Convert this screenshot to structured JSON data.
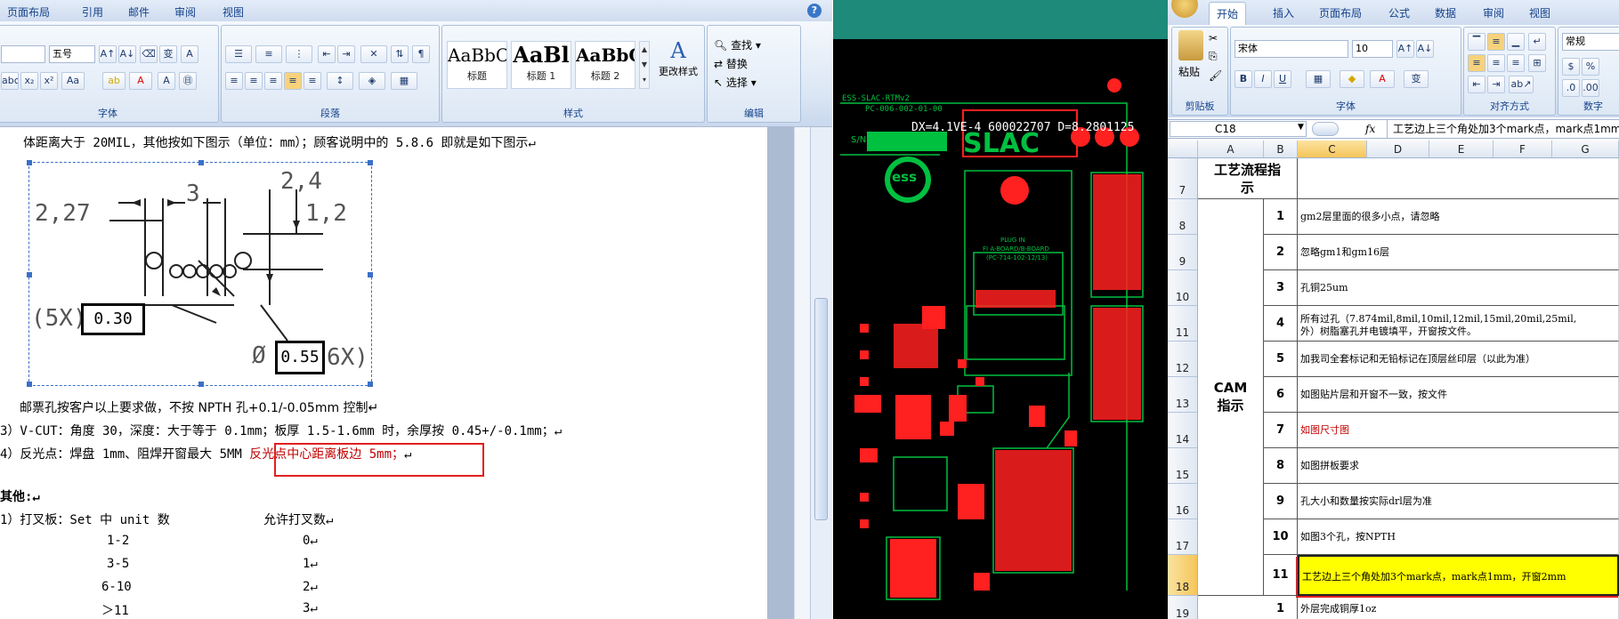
{
  "word": {
    "tabs": [
      "页面布局",
      "引用",
      "邮件",
      "审阅",
      "视图"
    ],
    "help": "?",
    "font_size": "五号",
    "font_group_label": "字体",
    "paragraph_group_label": "段落",
    "styles_group_label": "样式",
    "edit_group_label": "编辑",
    "styles": [
      {
        "preview": "AaBbC",
        "caption": "标题"
      },
      {
        "preview": "AaBl",
        "caption": "标题 1"
      },
      {
        "preview": "AaBbC",
        "caption": "标题 2"
      }
    ],
    "change_styles": "更改样式",
    "find": "查找",
    "replace": "替换",
    "select": "选择",
    "doc_lines": {
      "line1": "体距离大于 20MIL，其他按如下图示（单位：mm）；顾客说明中的 5.8.6 即就是如下图示↵",
      "line2": "邮票孔按客户以上要求做，不按 NPTH 孔+0.1/-0.05mm 控制↵",
      "line3": "3）V-CUT：角度 30，深度：大于等于 0.1mm；板厚 1.5-1.6mm 时，余厚按 0.45+/-0.1mm；↵",
      "line4a": "4）反光点：焊盘 1mm、阻焊开窗最大 5MM",
      "line4b": "反光点中心距离板边 5mm；",
      "line4c": "↵",
      "other": "其他:↵",
      "line5a": "1）打叉板：Set 中 unit 数",
      "line5b": "允许打叉数↵"
    },
    "table_rows": [
      {
        "range": "1-2",
        "count": "0↵"
      },
      {
        "range": "3-5",
        "count": "1↵"
      },
      {
        "range": "6-10",
        "count": "2↵"
      },
      {
        "range": "＞11",
        "count": "3↵"
      }
    ],
    "figure_labels": {
      "a": "2,27",
      "b": "3",
      "c": "2,4",
      "d": "1,2",
      "e": "(5X)",
      "f": "0.30",
      "g": "Ø",
      "h": "0.55",
      "i": "6X)"
    }
  },
  "pcb": {
    "text1": "ESS-SLAC-RTMv2",
    "text2": "PC-006-002-01-00",
    "coord": "DX=4.1VE-4 600022707 D=8.2801125",
    "sn": "S/N",
    "logo": "ess",
    "brand": "SLAC",
    "plug": "PLUG IN",
    "plug2": "FI A-BOARD/B-BOARD",
    "plug3": "(PC-714-102-12/13)"
  },
  "excel": {
    "tabs": [
      "开始",
      "插入",
      "页面布局",
      "公式",
      "数据",
      "审阅",
      "视图"
    ],
    "font_name": "宋体",
    "font_size": "10",
    "number_format": "常规",
    "paste": "粘贴",
    "clipboard_label": "剪贴板",
    "font_label": "字体",
    "align_label": "对齐方式",
    "number_label": "数字",
    "name_box": "C18",
    "fx": "fx",
    "formula": "工艺边上三个角处加3个mark点，mark点1mm，开窗2mm",
    "columns": [
      "A",
      "B",
      "C",
      "D",
      "E",
      "F",
      "G"
    ],
    "header_title": "工艺流程指示",
    "cam_label": "CAM指示",
    "rows": [
      {
        "rownum": "7",
        "num": "",
        "text": ""
      },
      {
        "rownum": "8",
        "num": "1",
        "text": "gm2层里面的很多小点，请忽略"
      },
      {
        "rownum": "9",
        "num": "2",
        "text": "忽略gm1和gm16层"
      },
      {
        "rownum": "10",
        "num": "3",
        "text": "孔铜25um"
      },
      {
        "rownum": "11",
        "num": "4",
        "text": "所有过孔（7.874mil,8mil,10mil,12mil,15mil,20mil,25mil,",
        "text2": "外）树脂塞孔并电镀填平，开窗按文件。"
      },
      {
        "rownum": "12",
        "num": "5",
        "text": "加我司全套标记和无铅标记在顶层丝印层（以此为准）"
      },
      {
        "rownum": "13",
        "num": "6",
        "text": "如图贴片层和开窗不一致，按文件"
      },
      {
        "rownum": "14",
        "num": "7",
        "text": "如图尺寸图"
      },
      {
        "rownum": "15",
        "num": "8",
        "text": "如图拼板要求"
      },
      {
        "rownum": "16",
        "num": "9",
        "text": "孔大小和数量按实际drl层为准"
      },
      {
        "rownum": "17",
        "num": "10",
        "text": "如图3个孔，按NPTH"
      },
      {
        "rownum": "18",
        "num": "11",
        "text": "工艺边上三个角处加3个mark点，mark点1mm，开窗2mm"
      },
      {
        "rownum": "19",
        "num": "1",
        "text": "外层完成铜厚1oz"
      }
    ]
  }
}
